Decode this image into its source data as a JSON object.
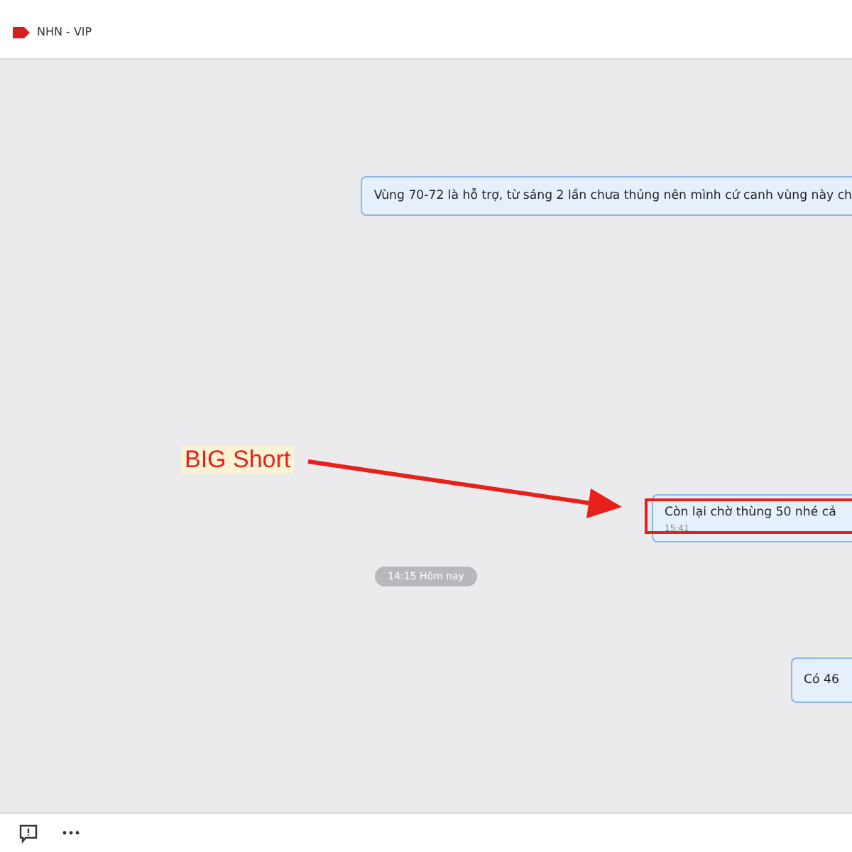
{
  "header": {
    "tag_label": "NHN - VIP"
  },
  "messages": [
    {
      "kind": "bubble",
      "text": "Vùng 70-72 là hỗ trợ, từ sáng 2 lần chưa thủng nên mình cứ canh vùng này ch"
    },
    {
      "kind": "bubble",
      "text": "Còn lại chờ thùng 50 nhé cả",
      "time": "15:41",
      "highlighted": true
    },
    {
      "kind": "date",
      "text": "14:15 Hôm nay"
    },
    {
      "kind": "bubble",
      "text": "Có 46"
    }
  ],
  "annotation": {
    "label": "BIG Short"
  }
}
